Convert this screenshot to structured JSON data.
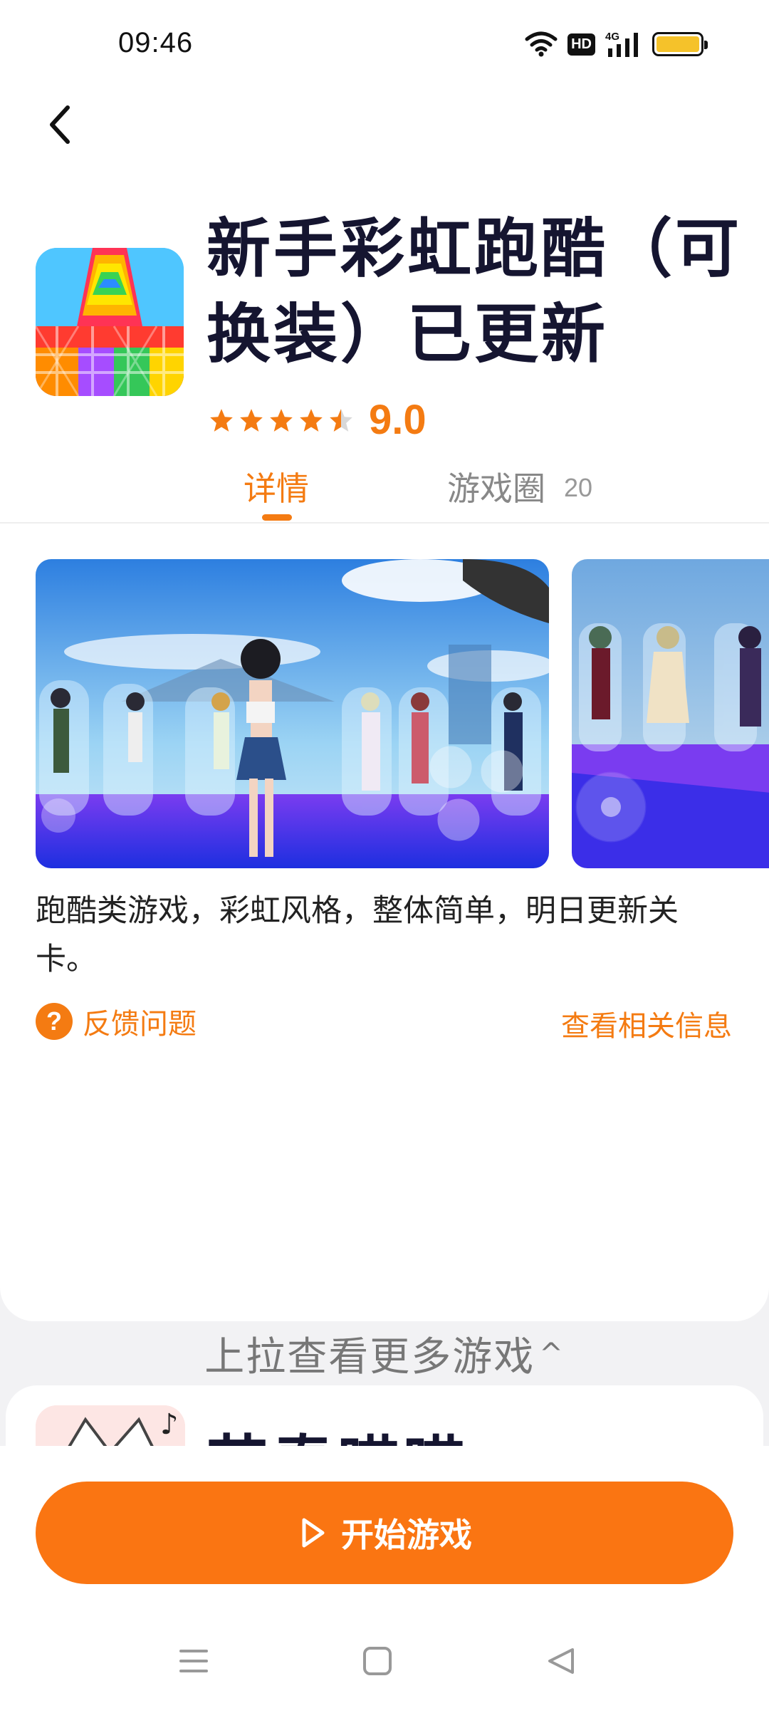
{
  "status_bar": {
    "time": "09:46",
    "hd_label": "HD",
    "network_label": "4G",
    "battery_color": "#f5c22a"
  },
  "header": {
    "back_icon": "chevron-left-icon"
  },
  "app": {
    "title": "新手彩虹跑酷（可换装）已更新",
    "rating_value": "9.0",
    "stars_filled": 4.5,
    "stars_total": 5,
    "accent_color": "#f47b12"
  },
  "tabs": [
    {
      "label": "详情",
      "active": true
    },
    {
      "label": "游戏圈",
      "count": "20",
      "active": false
    }
  ],
  "description": "跑酷类游戏，彩虹风格，整体简单，明日更新关卡。",
  "feedback": {
    "icon_glyph": "?",
    "label": "反馈问题"
  },
  "related_link": "查看相关信息",
  "pull_hint": {
    "label": "上拉查看更多游戏",
    "chevron": "^"
  },
  "next_game": {
    "title": "节奏喵喵"
  },
  "start_button": {
    "label": "开始游戏",
    "icon": "play-icon",
    "color": "#fa7512"
  },
  "nav_bar": {
    "menu_icon": "menu-icon",
    "home_icon": "home-square-icon",
    "back_icon": "back-triangle-icon"
  }
}
